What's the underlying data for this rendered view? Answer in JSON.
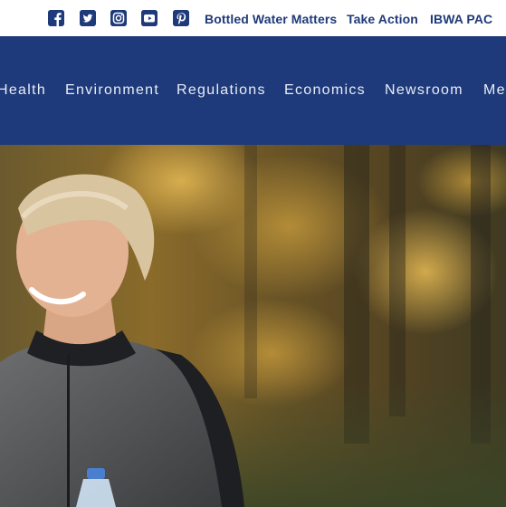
{
  "topbar": {
    "social_icons": [
      "facebook-icon",
      "twitter-icon",
      "instagram-icon",
      "youtube-icon",
      "pinterest-icon"
    ],
    "links": [
      "Bottled Water Matters",
      "Take Action",
      "IBWA PAC"
    ],
    "brand_color": "#1f3a7a"
  },
  "nav": {
    "items": [
      "Health",
      "Environment",
      "Regulations",
      "Economics",
      "Newsroom",
      "Me"
    ],
    "background": "#1f3a7a",
    "text_color": "#e8edf7"
  },
  "hero": {
    "image": "woman-with-water-bottle-autumn-forest"
  }
}
